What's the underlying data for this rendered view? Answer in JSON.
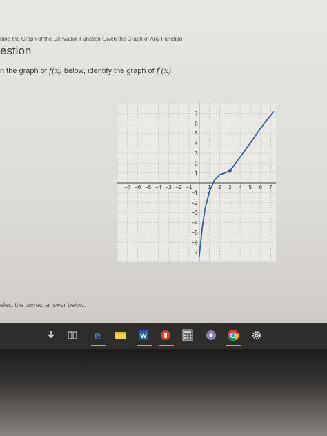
{
  "page": {
    "breadcrumb": "nine the Graph of the Derivative Function Given the Graph of Any Function",
    "heading": "estion",
    "instruction_prefix": "n the graph of ",
    "instruction_f": "f(x)",
    "instruction_mid": " below, identify the graph of ",
    "instruction_fp": "f′(x)",
    "instruction_end": ".",
    "footer": "elect the correct answer below:"
  },
  "chart_data": {
    "type": "line",
    "title": "",
    "xlabel": "",
    "ylabel": "",
    "xlim": [
      -8,
      7.5
    ],
    "ylim": [
      -8,
      8
    ],
    "x_ticks": [
      -7,
      -6,
      -5,
      -4,
      -3,
      -2,
      -1,
      1,
      2,
      3,
      4,
      5,
      6,
      7
    ],
    "x_tick_labels": [
      "−7",
      "−6",
      "−5",
      "−4",
      "−3",
      "−2",
      "−1",
      "1",
      "2",
      "3",
      "4",
      "5",
      "6",
      "7"
    ],
    "y_ticks": [
      7,
      6,
      5,
      4,
      3,
      2,
      1,
      -1,
      -2,
      -3,
      -4,
      -5,
      -6,
      -7
    ],
    "y_tick_labels": [
      "7",
      "6",
      "5",
      "4",
      "3",
      "2",
      "1",
      "−1",
      "−2",
      "−3",
      "−4",
      "−5",
      "−6",
      "−7"
    ],
    "grid": true,
    "series": [
      {
        "values_x": [
          0,
          0.3,
          0.6,
          1,
          1.5,
          2,
          2.5,
          3,
          4,
          5,
          6,
          7.3
        ],
        "values_y": [
          -7.5,
          -4.5,
          -2.5,
          -0.9,
          0.3,
          0.8,
          1.0,
          1.2,
          2.6,
          4.0,
          5.5,
          7.2
        ],
        "color": "#2f5fa0"
      }
    ],
    "points": [
      {
        "x": 3,
        "y": 1.2,
        "color": "#2f5fa0"
      }
    ]
  },
  "taskbar": {
    "icons": [
      "download-icon",
      "task-view-icon",
      "edge-icon",
      "file-explorer-icon",
      "word-icon",
      "powerpoint-icon",
      "calculator-icon",
      "groove-music-icon",
      "chrome-icon",
      "settings-icon"
    ],
    "word_label": "W",
    "accent": "#7bb4e6"
  }
}
